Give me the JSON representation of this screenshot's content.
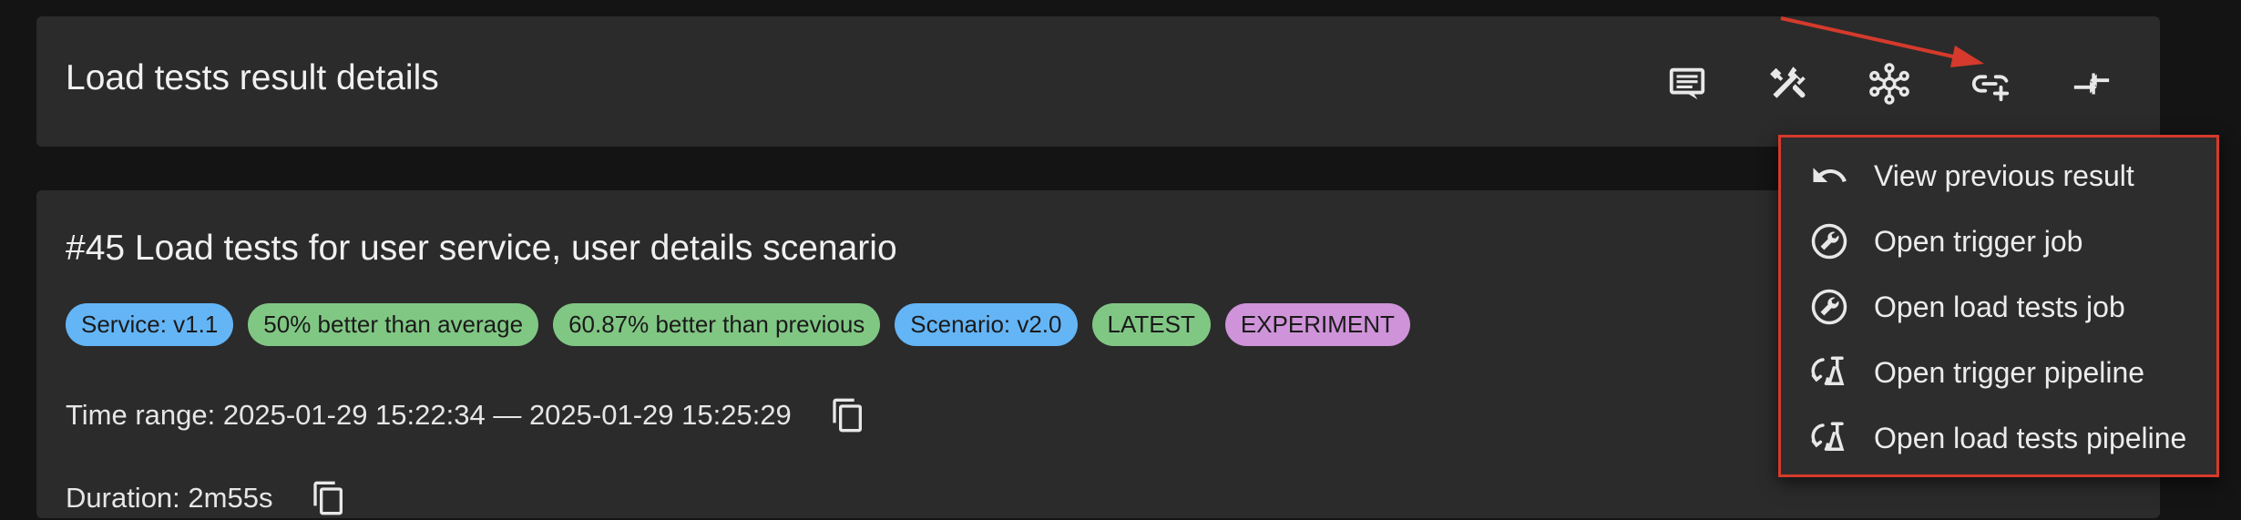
{
  "header": {
    "title": "Load tests result details",
    "icons": [
      "comment-icon",
      "tools-icon",
      "graph-network-icon",
      "link-plus-icon",
      "compare-arrows-icon"
    ]
  },
  "result": {
    "title": "#45 Load tests for user service, user details scenario",
    "chips": [
      {
        "label": "Service: v1.1",
        "color": "#64b5f6"
      },
      {
        "label": "50% better than average",
        "color": "#81c784"
      },
      {
        "label": "60.87% better than previous",
        "color": "#81c784"
      },
      {
        "label": "Scenario: v2.0",
        "color": "#64b5f6"
      },
      {
        "label": "LATEST",
        "color": "#81c784"
      },
      {
        "label": "EXPERIMENT",
        "color": "#ce93d8"
      }
    ],
    "time_range": "Time range: 2025-01-29 15:22:34 — 2025-01-29 15:25:29",
    "duration": "Duration: 2m55s"
  },
  "menu": {
    "items": [
      {
        "label": "View previous result",
        "icon": "undo-icon"
      },
      {
        "label": "Open trigger job",
        "icon": "wrench-circle-icon"
      },
      {
        "label": "Open load tests job",
        "icon": "wrench-circle-icon"
      },
      {
        "label": "Open trigger pipeline",
        "icon": "pipeline-icon"
      },
      {
        "label": "Open load tests pipeline",
        "icon": "pipeline-icon"
      }
    ]
  },
  "colors": {
    "background": "#141414",
    "card": "#2b2b2b",
    "annotation": "#d53a2c"
  }
}
